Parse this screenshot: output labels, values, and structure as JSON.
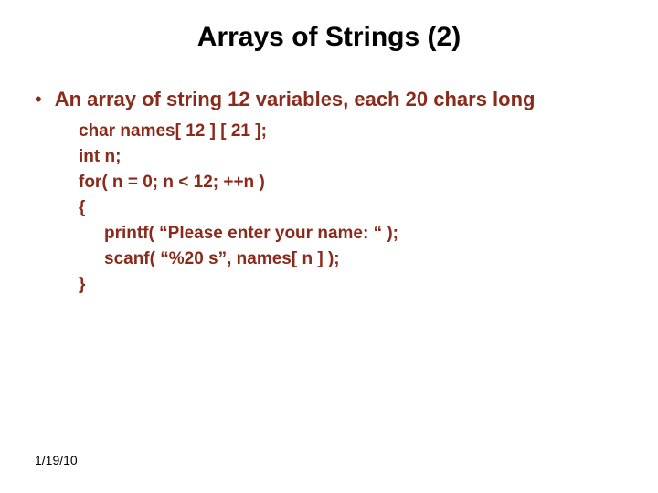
{
  "title": "Arrays of Strings (2)",
  "bullet": "An array of string 12 variables, each 20 chars long",
  "code": {
    "l1": "char names[ 12 ] [ 21 ];",
    "l2": "int n;",
    "l3": "for( n = 0; n < 12; ++n )",
    "l4": "{",
    "l5": "printf( “Please enter your name: “ );",
    "l6": "scanf( “%20 s”, names[ n ] );",
    "l7": "}"
  },
  "date": "1/19/10"
}
